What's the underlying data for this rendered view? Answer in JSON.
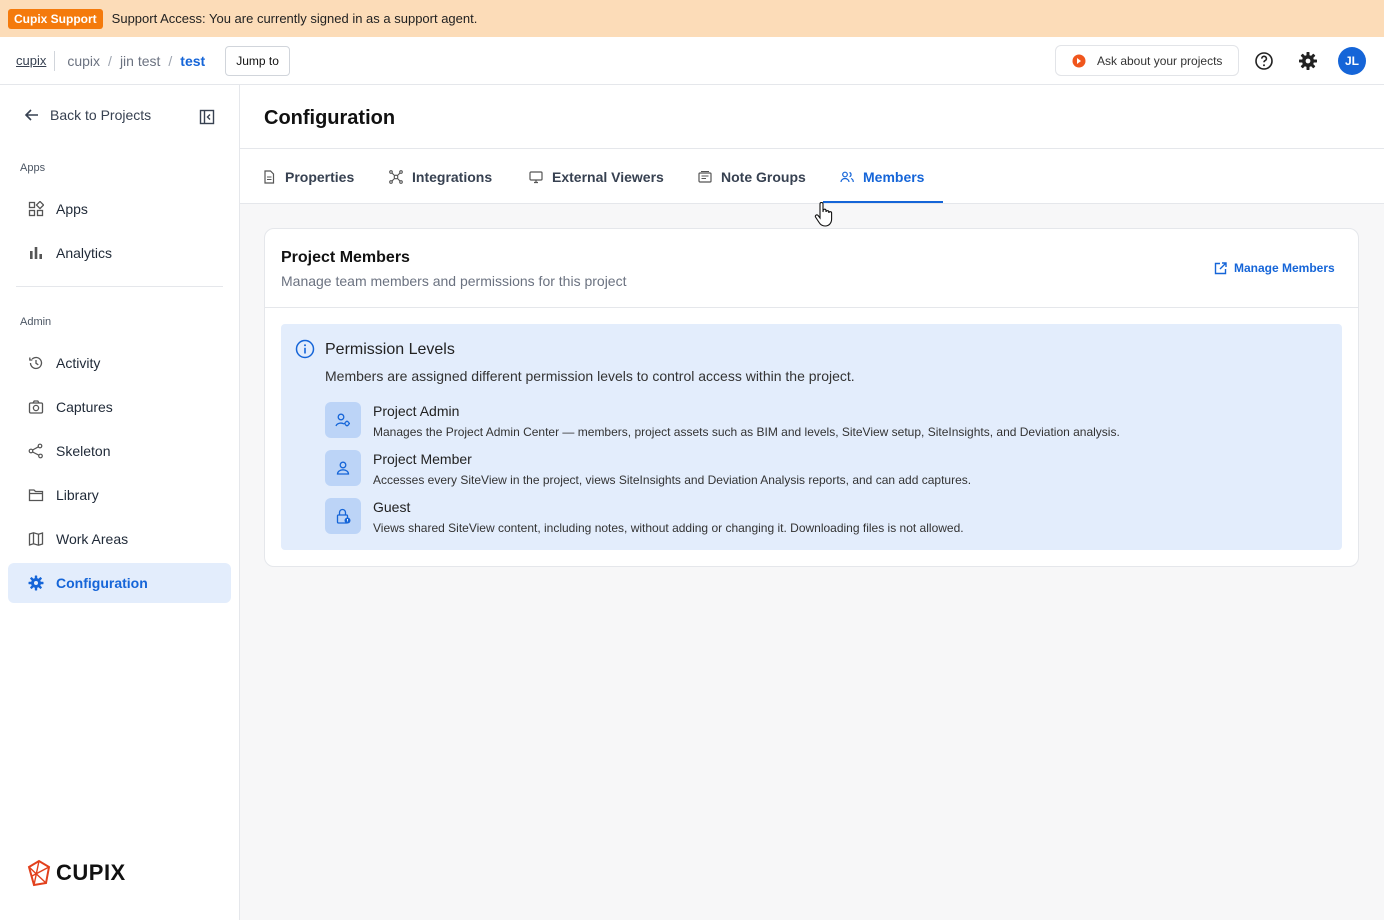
{
  "support": {
    "badge": "Cupix Support",
    "message": "Support Access: You are currently signed in as a support agent."
  },
  "topbar": {
    "root": "cupix",
    "crumbs": [
      "cupix",
      "jin test",
      "test"
    ],
    "jump_label": "Jump to",
    "ask_label": "Ask about your projects",
    "avatar_initials": "JL"
  },
  "sidebar": {
    "back_label": "Back to Projects",
    "section_apps": "Apps",
    "section_admin": "Admin",
    "items": [
      {
        "label": "Apps",
        "icon": "grid-icon"
      },
      {
        "label": "Analytics",
        "icon": "bar-chart-icon"
      },
      {
        "label": "Activity",
        "icon": "history-icon"
      },
      {
        "label": "Captures",
        "icon": "camera-icon"
      },
      {
        "label": "Skeleton",
        "icon": "nodes-icon"
      },
      {
        "label": "Library",
        "icon": "folder-icon"
      },
      {
        "label": "Work Areas",
        "icon": "map-icon"
      },
      {
        "label": "Configuration",
        "icon": "gear-icon"
      }
    ],
    "logo_text": "CUPIX"
  },
  "main": {
    "title": "Configuration",
    "tabs": [
      {
        "label": "Properties",
        "icon": "document-icon"
      },
      {
        "label": "Integrations",
        "icon": "network-icon"
      },
      {
        "label": "External Viewers",
        "icon": "monitor-icon"
      },
      {
        "label": "Note Groups",
        "icon": "notes-icon"
      },
      {
        "label": "Members",
        "icon": "users-icon"
      }
    ],
    "active_tab": "Members"
  },
  "members_card": {
    "title": "Project Members",
    "subtitle": "Manage team members and permissions for this project",
    "manage_label": "Manage Members",
    "info": {
      "title": "Permission Levels",
      "description": "Members are assigned different permission levels to control access within the project.",
      "levels": [
        {
          "name": "Project Admin",
          "description": "Manages the Project Admin Center — members, project assets such as BIM and levels, SiteView setup, SiteInsights, and Deviation analysis."
        },
        {
          "name": "Project Member",
          "description": "Accesses every SiteView in the project, views SiteInsights and Deviation Analysis reports, and can add captures."
        },
        {
          "name": "Guest",
          "description": "Views shared SiteView content, including notes, without adding or changing it. Downloading files is not allowed."
        }
      ]
    }
  },
  "colors": {
    "accent": "#1565d8",
    "support_bg": "#fcdcb8",
    "support_badge": "#f47a0c",
    "info_bg": "#e3edfc"
  }
}
